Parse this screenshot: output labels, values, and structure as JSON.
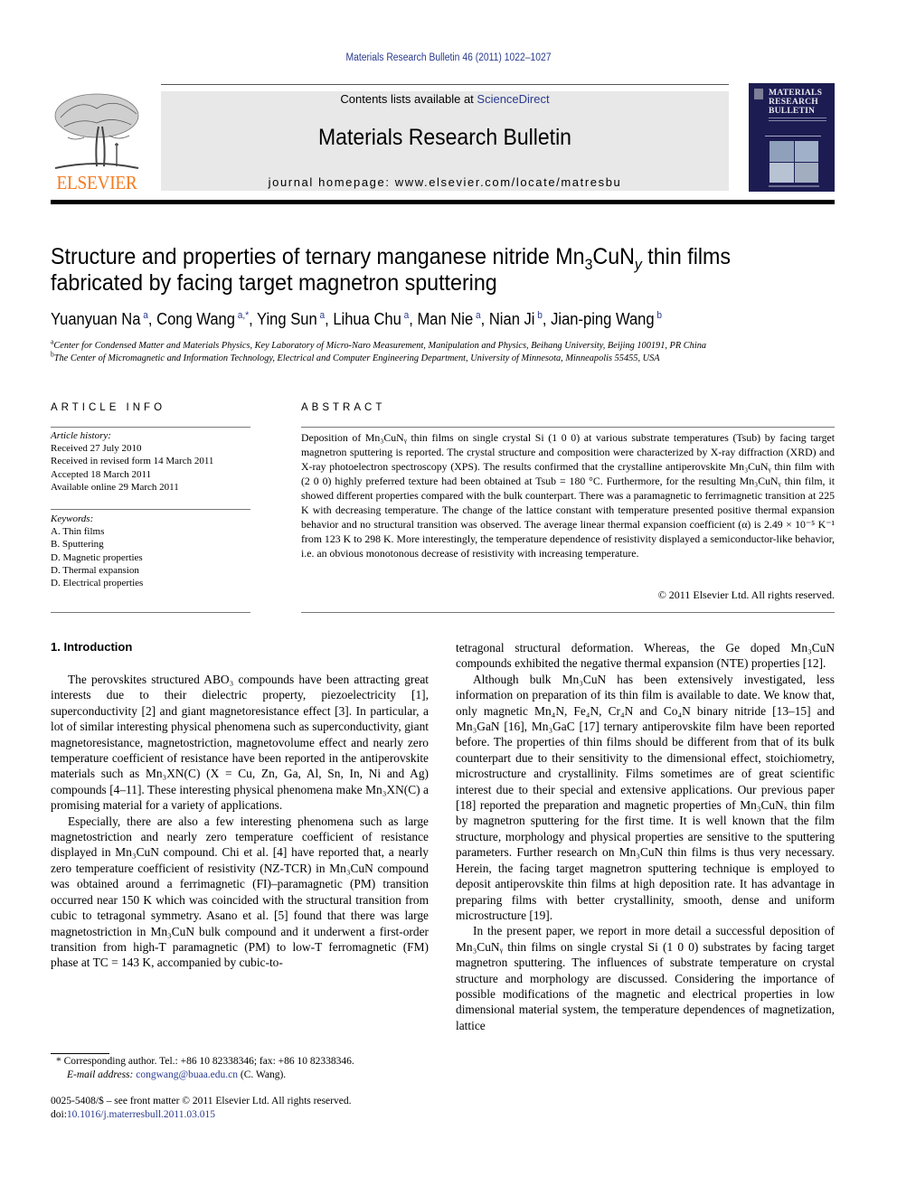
{
  "header": {
    "citation": "Materials Research Bulletin 46 (2011) 1022–1027",
    "contents_prefix": "Contents lists available at ",
    "contents_link": "ScienceDirect",
    "journal_title": "Materials Research Bulletin",
    "homepage": "journal homepage: www.elsevier.com/locate/matresbu",
    "publisher_logo": "ELSEVIER",
    "cover_title": [
      "MATERIALS",
      "RESEARCH",
      "BULLETIN"
    ],
    "colors": {
      "logo_orange": "#f47b20",
      "cover_navy": "#1d1c52",
      "link_blue": "#2a3b8f",
      "header_box_gray": "#e8e8e8"
    }
  },
  "article": {
    "title_part1": "Structure and properties of ternary manganese nitride Mn",
    "title_sub": "3",
    "title_part2": "CuN",
    "title_italic_sub": "y",
    "title_part3": " thin films fabricated by facing target magnetron sputtering",
    "authors": [
      {
        "name": "Yuanyuan Na",
        "aff": "a"
      },
      {
        "name": "Cong Wang",
        "aff": "a,*"
      },
      {
        "name": "Ying Sun",
        "aff": "a"
      },
      {
        "name": "Lihua Chu",
        "aff": "a"
      },
      {
        "name": "Man Nie",
        "aff": "a"
      },
      {
        "name": "Nian Ji",
        "aff": "b"
      },
      {
        "name": "Jian-ping Wang",
        "aff": "b"
      }
    ],
    "affiliations": [
      {
        "key": "a",
        "text": "Center for Condensed Matter and Materials Physics, Key Laboratory of Micro-Naro Measurement, Manipulation and Physics, Beihang University, Beijing 100191, PR China"
      },
      {
        "key": "b",
        "text": "The Center of Micromagnetic and Information Technology, Electrical and Computer Engineering Department, University of Minnesota, Minneapolis 55455, USA"
      }
    ]
  },
  "article_info": {
    "caption": "ARTICLE INFO",
    "history_heading": "Article history:",
    "history": [
      "Received 27 July 2010",
      "Received in revised form 14 March 2011",
      "Accepted 18 March 2011",
      "Available online 29 March 2011"
    ],
    "keywords_heading": "Keywords:",
    "keywords": [
      "A. Thin films",
      "B. Sputtering",
      "D. Magnetic properties",
      "D. Thermal expansion",
      "D. Electrical properties"
    ]
  },
  "abstract": {
    "caption": "ABSTRACT",
    "text": "Deposition of Mn₃CuNᵧ thin films on single crystal Si (1 0 0) at various substrate temperatures (Tsub) by facing target magnetron sputtering is reported. The crystal structure and composition were characterized by X-ray diffraction (XRD) and X-ray photoelectron spectroscopy (XPS). The results confirmed that the crystalline antiperovskite Mn₃CuNᵧ thin film with (2 0 0) highly preferred texture had been obtained at Tsub = 180 °C. Furthermore, for the resulting Mn₃CuNᵧ thin film, it showed different properties compared with the bulk counterpart. There was a paramagnetic to ferrimagnetic transition at 225 K with decreasing temperature. The change of the lattice constant with temperature presented positive thermal expansion behavior and no structural transition was observed. The average linear thermal expansion coefficient (α) is 2.49 × 10⁻⁵ K⁻¹ from 123 K to 298 K. More interestingly, the temperature dependence of resistivity displayed a semiconductor-like behavior, i.e. an obvious monotonous decrease of resistivity with increasing temperature.",
    "copyright": "© 2011 Elsevier Ltd. All rights reserved."
  },
  "intro": {
    "heading": "1.  Introduction",
    "left_paragraphs": [
      "The perovskites structured ABO₃ compounds have been attracting great interests due to their dielectric property, piezoelectricity [1], superconductivity [2] and giant magnetoresistance effect [3]. In particular, a lot of similar interesting physical phenomena such as superconductivity, giant magnetoresistance, magnetostriction, magnetovolume effect and nearly zero temperature coefficient of resistance have been reported in the antiperovskite materials such as Mn₃XN(C) (X = Cu, Zn, Ga, Al, Sn, In, Ni and Ag) compounds [4–11]. These interesting physical phenomena make Mn₃XN(C) a promising material for a variety of applications.",
      "Especially, there are also a few interesting phenomena such as large magnetostriction and nearly zero temperature coefficient of resistance displayed in Mn₃CuN compound. Chi et al. [4] have reported that, a nearly zero temperature coefficient of resistivity (NZ-TCR) in Mn₃CuN compound was obtained around a ferrimagnetic (FI)–paramagnetic (PM) transition occurred near 150 K which was coincided with the structural transition from cubic to tetragonal symmetry. Asano et al. [5] found that there was large magnetostriction in Mn₃CuN bulk compound and it underwent a first-order transition from high-T paramagnetic (PM) to low-T ferromagnetic (FM) phase at TC = 143 K, accompanied by cubic-to-"
    ],
    "right_paragraphs": [
      "tetragonal structural deformation. Whereas, the Ge doped Mn₃CuN compounds exhibited the negative thermal expansion (NTE) properties [12].",
      "Although bulk Mn₃CuN has been extensively investigated, less information on preparation of its thin film is available to date. We know that, only magnetic Mn₄N, Fe₄N, Cr₄N and Co₄N binary nitride [13–15] and Mn₃GaN [16], Mn₃GaC [17] ternary antiperovskite film have been reported before. The properties of thin films should be different from that of its bulk counterpart due to their sensitivity to the dimensional effect, stoichiometry, microstructure and crystallinity. Films sometimes are of great scientific interest due to their special and extensive applications. Our previous paper [18] reported the preparation and magnetic properties of Mn₃CuNₓ thin film by magnetron sputtering for the first time. It is well known that the film structure, morphology and physical properties are sensitive to the sputtering parameters. Further research on Mn₃CuN thin films is thus very necessary. Herein, the facing target magnetron sputtering technique is employed to deposit antiperovskite thin films at high deposition rate. It has advantage in preparing films with better crystallinity, smooth, dense and uniform microstructure [19].",
      "In the present paper, we report in more detail a successful deposition of Mn₃CuNᵧ thin films on single crystal Si (1 0 0) substrates by facing target magnetron sputtering. The influences of substrate temperature on crystal structure and morphology are discussed. Considering the importance of possible modifications of the magnetic and electrical properties in low dimensional material system, the temperature dependences of magnetization, lattice"
    ]
  },
  "footnote": {
    "corresponding": "* Corresponding author. Tel.: +86 10 82338346; fax: +86 10 82338346.",
    "email_label": "E-mail address: ",
    "email": "congwang@buaa.edu.cn",
    "email_suffix": " (C. Wang)."
  },
  "front_matter": {
    "issn_line": "0025-5408/$ – see front matter © 2011 Elsevier Ltd. All rights reserved.",
    "doi_prefix": "doi:",
    "doi": "10.1016/j.materresbull.2011.03.015"
  }
}
